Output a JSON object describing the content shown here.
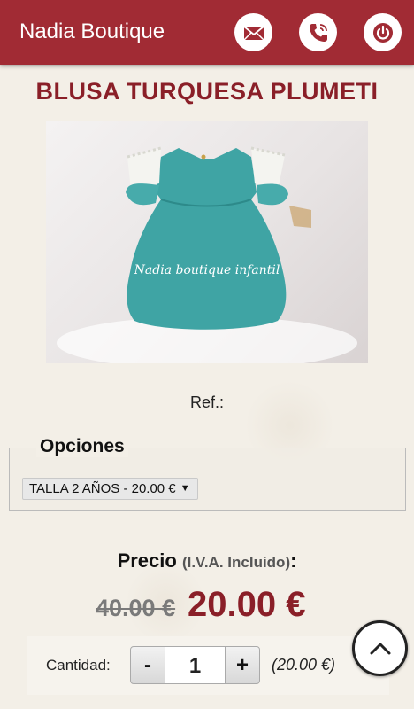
{
  "header": {
    "brand": "Nadia Boutique",
    "icons": [
      "mail-icon",
      "phone-icon",
      "power-icon"
    ],
    "bar_color": "#a12b34"
  },
  "product": {
    "title": "BLUSA TURQUESA PLUMETI",
    "image_watermark": "Nadia boutique infantil",
    "ref_label": "Ref.:"
  },
  "options": {
    "legend": "Opciones",
    "selected": "TALLA 2 AÑOS - 20.00 €"
  },
  "price": {
    "label": "Precio",
    "tax_note": "(I.V.A. Incluido)",
    "colon": ":",
    "old": "40.00 €",
    "current": "20.00 €",
    "accent_color": "#8a1f28"
  },
  "quantity": {
    "label": "Cantidad:",
    "minus": "-",
    "value": "1",
    "plus": "+",
    "subtotal": "(20.00 €)"
  }
}
